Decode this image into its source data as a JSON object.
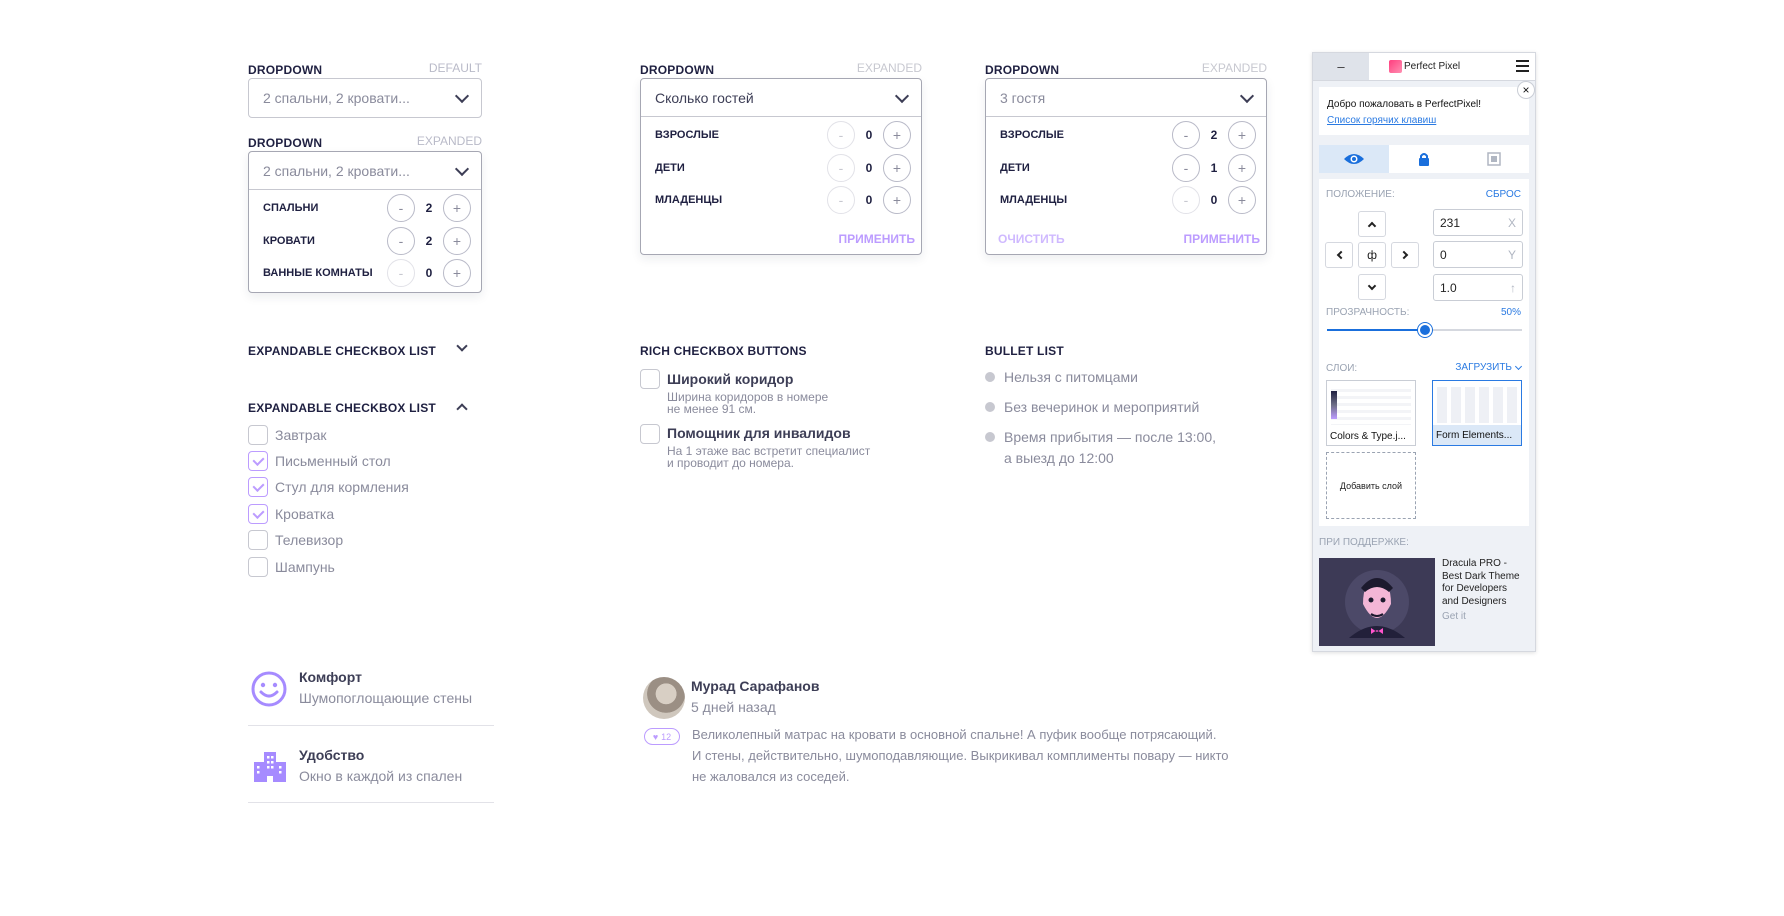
{
  "dropdown1": {
    "title": "DROPDOWN",
    "state": "DEFAULT",
    "value": "2 спальни, 2 кровати..."
  },
  "dropdown2": {
    "title": "DROPDOWN",
    "state": "EXPANDED",
    "value": "2 спальни, 2 кровати...",
    "rows": [
      {
        "label": "СПАЛЬНИ",
        "count": "2"
      },
      {
        "label": "КРОВАТИ",
        "count": "2"
      },
      {
        "label": "ВАННЫЕ КОМНАТЫ",
        "count": "0"
      }
    ]
  },
  "dropdown3": {
    "title": "DROPDOWN",
    "state": "EXPANDED",
    "value": "Сколько гостей",
    "rows": [
      {
        "label": "ВЗРОСЛЫЕ",
        "count": "0"
      },
      {
        "label": "ДЕТИ",
        "count": "0"
      },
      {
        "label": "МЛАДЕНЦЫ",
        "count": "0"
      }
    ],
    "apply": "ПРИМЕНИТЬ"
  },
  "dropdown4": {
    "title": "DROPDOWN",
    "state": "EXPANDED",
    "value": "3 гостя",
    "rows": [
      {
        "label": "ВЗРОСЛЫЕ",
        "count": "2"
      },
      {
        "label": "ДЕТИ",
        "count": "1"
      },
      {
        "label": "МЛАДЕНЦЫ",
        "count": "0"
      }
    ],
    "clear": "ОЧИСТИТЬ",
    "apply": "ПРИМЕНИТЬ"
  },
  "checklist_collapsed": {
    "title": "EXPANDABLE CHECKBOX LIST"
  },
  "checklist_expanded": {
    "title": "EXPANDABLE CHECKBOX LIST",
    "items": [
      {
        "label": "Завтрак",
        "checked": false
      },
      {
        "label": "Письменный стол",
        "checked": true
      },
      {
        "label": "Стул для кормления",
        "checked": true
      },
      {
        "label": "Кроватка",
        "checked": true
      },
      {
        "label": "Телевизор",
        "checked": false
      },
      {
        "label": "Шампунь",
        "checked": false
      }
    ]
  },
  "rich": {
    "title": "RICH CHECKBOX BUTTONS",
    "items": [
      {
        "title": "Широкий коридор",
        "sub1": "Ширина коридоров в номере",
        "sub2": "не менее 91 см."
      },
      {
        "title": "Помощник для инвалидов",
        "sub1": "На 1 этаже вас встретит специалист",
        "sub2": "и проводит до номера."
      }
    ]
  },
  "bullets": {
    "title": "BULLET LIST",
    "items": [
      {
        "line1": "Нельзя с питомцами",
        "line2": ""
      },
      {
        "line1": "Без вечеринок и мероприятий",
        "line2": ""
      },
      {
        "line1": "Время прибытия — после 13:00,",
        "line2": "а выезд до 12:00"
      }
    ]
  },
  "features": [
    {
      "icon": "smile-icon",
      "title": "Комфорт",
      "sub": "Шумопоглощающие стены"
    },
    {
      "icon": "building-icon",
      "title": "Удобство",
      "sub": "Окно в каждой из спален"
    }
  ],
  "review": {
    "author": "Мурад Сарафанов",
    "date": "5 дней назад",
    "likes": "12",
    "lines": [
      "Великолепный матрас на кровати в основной спальне! А пуфик вообще потрясающий.",
      "И стены, действительно, шумоподавляющие. Выкрикивал комплименты повару — никто",
      "не жаловался из соседей."
    ]
  },
  "perfectpixel": {
    "minimize": "–",
    "title": "Perfect Pixel",
    "welcome": "Добро пожаловать в PerfectPixel!",
    "hotkeys": "Список горячих клавиш",
    "position_label": "ПОЛОЖЕНИЕ:",
    "reset": "СБРОС",
    "x_value": "231",
    "x_axis": "X",
    "y_value": "0",
    "y_axis": "Y",
    "scale_value": "1.0",
    "scale_axis": "↑",
    "center_label": "ф",
    "opacity_label": "ПРОЗРАЧНОСТЬ:",
    "opacity_value": "50%",
    "opacity": 0.5,
    "layers_label": "СЛОИ:",
    "upload": "ЗАГРУЗИТЬ",
    "layers": [
      "Colors & Type.j...",
      "Form Elements..."
    ],
    "add_layer": "Добавить слой",
    "sponsor_label": "ПРИ ПОДДЕРЖКЕ:",
    "sponsor_lines": [
      "Dracula PRO -",
      "Best Dark Theme",
      "for Developers",
      "and Designers"
    ],
    "sponsor_cta": "Get it"
  },
  "colors": {
    "accent": "#bc9cff",
    "text": "#1f2041",
    "muted": "#8a8b9c",
    "border": "#c7c8d0",
    "pp_blue": "#2a7ae2"
  }
}
